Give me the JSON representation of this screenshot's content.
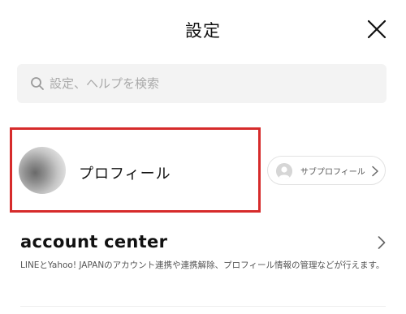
{
  "header": {
    "title": "設定",
    "close_icon": "close-icon"
  },
  "search": {
    "placeholder": "設定、ヘルプを検索",
    "icon": "search-icon"
  },
  "profile": {
    "label": "プロフィール",
    "highlight_color": "#d62b2b"
  },
  "sub_profile": {
    "label": "サブプロフィール",
    "icon": "person-icon"
  },
  "account_center": {
    "logo_text": "account center",
    "description": "LINEとYahoo! JAPANのアカウント連携や連携解除、プロフィール情報の管理などが行えます。"
  }
}
